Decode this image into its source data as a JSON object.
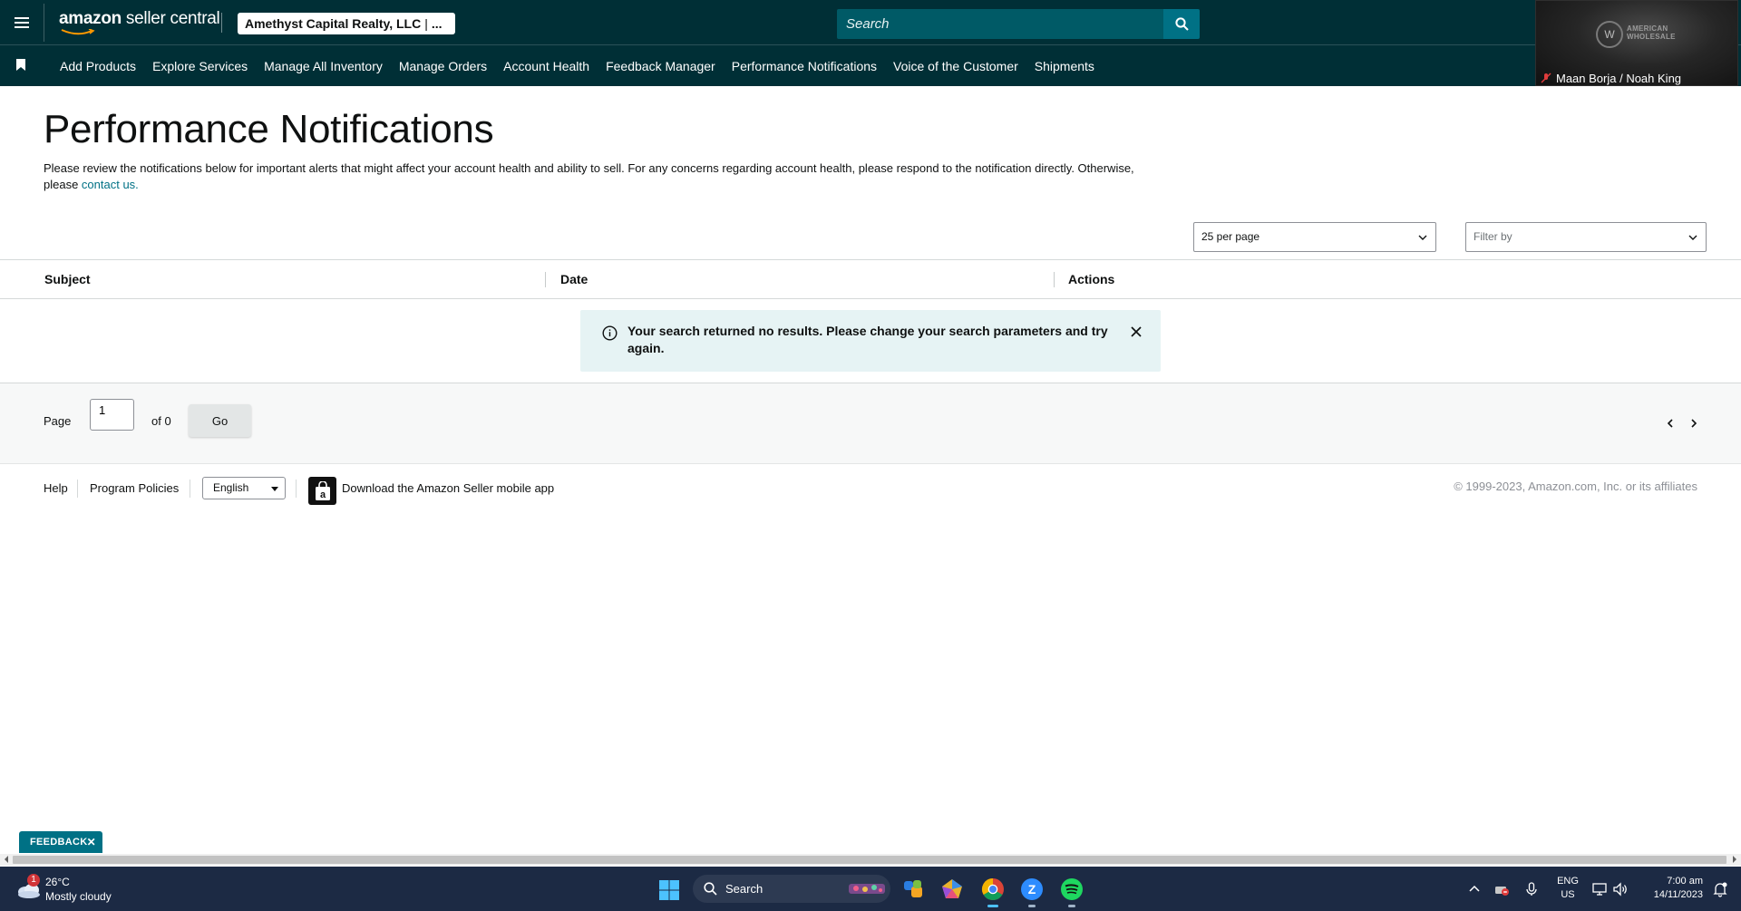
{
  "header": {
    "logo_text_bold": "amazon",
    "logo_text_rest": " seller central",
    "account_name": "Amethyst Capital Realty, LLC",
    "account_sep": "|",
    "account_more": "...",
    "search_placeholder": "Search"
  },
  "nav": {
    "items": [
      {
        "label": "Add Products"
      },
      {
        "label": "Explore Services"
      },
      {
        "label": "Manage All Inventory"
      },
      {
        "label": "Manage Orders"
      },
      {
        "label": "Account Health"
      },
      {
        "label": "Feedback Manager"
      },
      {
        "label": "Performance Notifications"
      },
      {
        "label": "Voice of the Customer"
      },
      {
        "label": "Shipments"
      }
    ]
  },
  "video_call": {
    "participant_name": "Maan Borja / Noah King",
    "brand_line1": "AMERICAN",
    "brand_line2": "WHOLESALE"
  },
  "page": {
    "title": "Performance Notifications",
    "description": "Please review the notifications below for important alerts that might affect your account health and ability to sell. For any concerns regarding account health, please respond to the notification directly. Otherwise, please ",
    "contact_link": "contact us.",
    "per_page": "25 per page",
    "filter_placeholder": "Filter by"
  },
  "table": {
    "columns": [
      "Subject",
      "Date",
      "Actions"
    ],
    "empty_message": "Your search returned no results. Please change your search parameters and try again."
  },
  "pager": {
    "page_label": "Page",
    "page_value": "1",
    "of_label": "of 0",
    "go_label": "Go"
  },
  "footer": {
    "help": "Help",
    "program_policies": "Program Policies",
    "language": "English",
    "download_app": "Download the Amazon Seller mobile app",
    "copyright": "© 1999-2023, Amazon.com, Inc. or its affiliates"
  },
  "feedback": {
    "label": "FEEDBACK",
    "close": "✕"
  },
  "taskbar": {
    "weather_badge": "1",
    "temperature": "26°C",
    "condition": "Mostly cloudy",
    "search_label": "Search",
    "lang_line1": "ENG",
    "lang_line2": "US",
    "time": "7:00 am",
    "date": "14/11/2023"
  },
  "colors": {
    "header_bg": "#002f36",
    "search_bg": "#005a66",
    "accent": "#007185",
    "alert_bg": "#e6f3f4"
  }
}
